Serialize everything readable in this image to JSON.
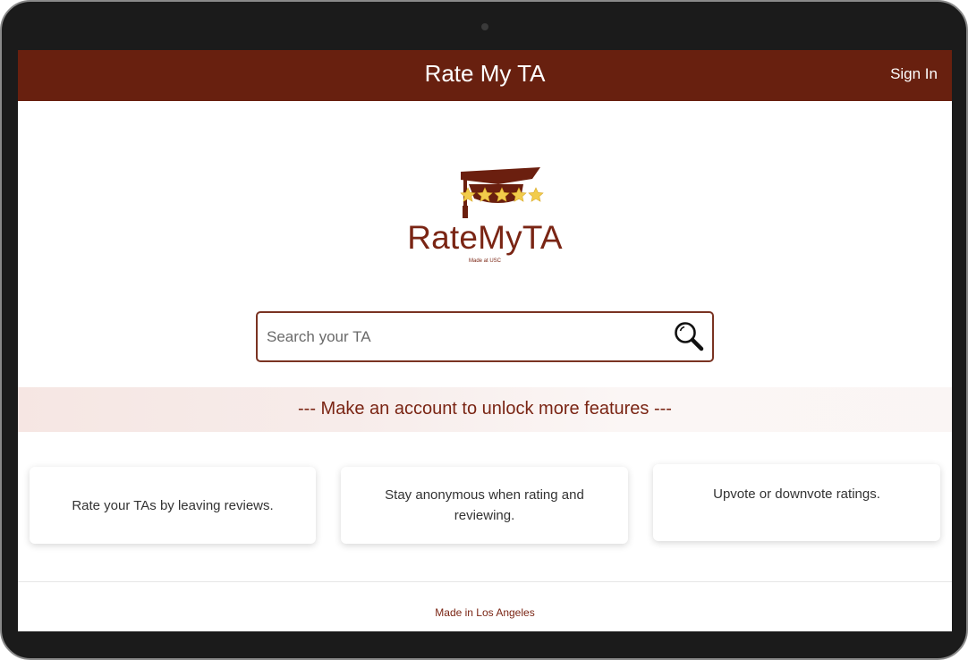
{
  "navbar": {
    "title": "Rate My TA",
    "sign_in_label": "Sign In"
  },
  "logo": {
    "text": "RateMyTA",
    "subtext": "Made at USC",
    "star_count": 4
  },
  "search": {
    "placeholder": "Search your TA",
    "value": ""
  },
  "banner": {
    "text": "--- Make an account to unlock more features ---"
  },
  "features": [
    {
      "text": "Rate your TAs by leaving reviews."
    },
    {
      "text": "Stay anonymous when rating and reviewing."
    },
    {
      "text": "Upvote or downvote ratings."
    }
  ],
  "footer": {
    "text": "Made in Los Angeles"
  },
  "colors": {
    "brand": "#68200f",
    "accent_text": "#7a2514",
    "star": "#f2cc4b"
  },
  "icons": {
    "logo_icon": "graduation-cap-with-stars-icon",
    "search_icon": "magnifying-glass-icon"
  }
}
